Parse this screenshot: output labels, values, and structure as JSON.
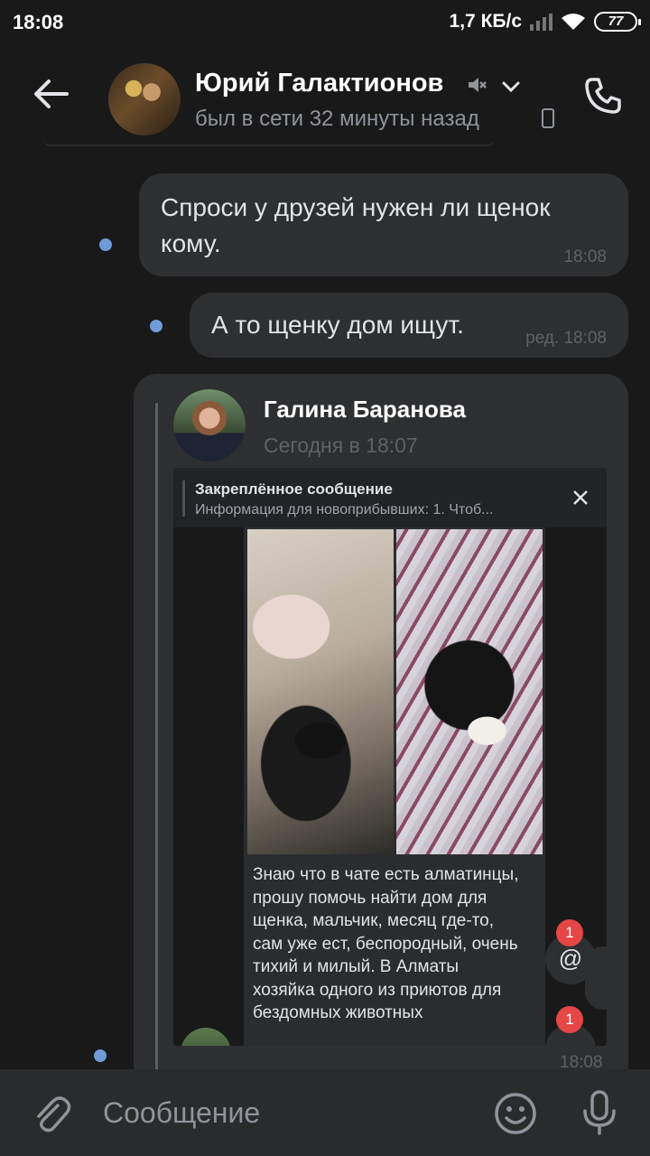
{
  "status_bar": {
    "time": "18:08",
    "net_speed": "1,7 КБ/с",
    "battery": "77"
  },
  "header": {
    "contact_name": "Юрий Галактионов",
    "last_seen": "был в сети 32 минуты назад",
    "icons": [
      "back-arrow-icon",
      "mute-icon",
      "chevron-down-icon",
      "mobile-phone-icon",
      "phone-call-icon"
    ]
  },
  "messages": [
    {
      "text": "Спроси у друзей нужен ли щенок кому.",
      "time": "18:08",
      "edited_prefix": ""
    },
    {
      "text": "А то щенку дом ищут.",
      "time": "18:08",
      "edited_prefix": "ред."
    }
  ],
  "forwarded": {
    "author": "Галина Баранова",
    "date": "Сегодня в 18:07",
    "time": "18:08",
    "screenshot": {
      "pinned_title": "Закреплённое сообщение",
      "pinned_text": "Информация для новоприбывших:  1. Чтоб...",
      "message_text": "Знаю что в чате есть алматинцы, прошу помочь найти дом для щенка, мальчик, месяц где-то, сам уже ест, беспородный, очень тихий и милый. В Алматы хозяйка одного из приютов для бездомных животных",
      "mention_badge": "1",
      "down_badge": "1",
      "mention_symbol": "@"
    }
  },
  "composer": {
    "placeholder": "Сообщение",
    "icons": [
      "paperclip-icon",
      "emoji-icon",
      "microphone-icon"
    ]
  },
  "colors": {
    "background": "#19191a",
    "bubble": "#2e2f31",
    "unread_dot": "#6f9bd6",
    "badge": "#e64646"
  }
}
